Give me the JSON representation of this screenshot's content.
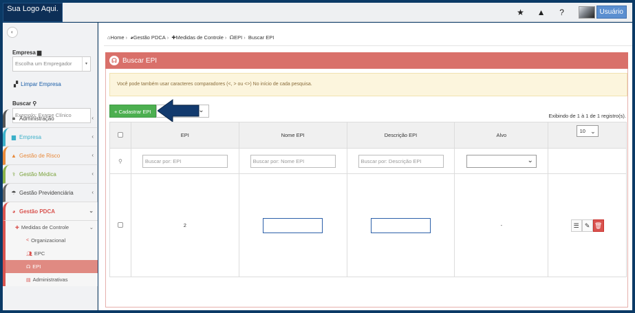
{
  "topbar": {
    "logo": "Sua Logo Aqui.",
    "icons": [
      "star-icon",
      "warning-icon",
      "help-icon"
    ],
    "user_label": "Usuário"
  },
  "sidebar": {
    "empresa_label": "Empresa",
    "empresa_placeholder": "Escolha um Empregador",
    "limpar_label": "Limpar Empresa",
    "buscar_label": "Buscar",
    "buscar_placeholder": "Exemplo: Exame Clínico",
    "menu": [
      {
        "label": "Administração"
      },
      {
        "label": "Empresa"
      },
      {
        "label": "Gestão de Risco"
      },
      {
        "label": "Gestão Médica"
      },
      {
        "label": "Gestão Previdenciária"
      },
      {
        "label": "Gestão PDCA"
      }
    ],
    "submenu": {
      "group": "Medidas de Controle",
      "items": [
        "Organizacional",
        "EPC",
        "EPI",
        "Administrativas"
      ]
    }
  },
  "breadcrumb": [
    "Home",
    "Gestão PDCA",
    "Medidas de Controle",
    "EPI",
    "Buscar EPI"
  ],
  "panel": {
    "title": "Buscar EPI",
    "alert": "Você pode também usar caracteres comparadores (<, > ou <>) No início de cada pesquisa.",
    "add_button": "+ Cadastrar EPI",
    "showing": "Exibindo de 1 à 1 de 1 registro(s)."
  },
  "table": {
    "columns": [
      "EPI",
      "Nome EPI",
      "Descrição EPI",
      "Alvo"
    ],
    "page_length": "10",
    "filters": {
      "epi": "Buscar por: EPI",
      "nome": "Buscar por: Nome EPI",
      "descricao": "Buscar por: Descrição EPI"
    },
    "rows": [
      {
        "epi": "2",
        "nome": "",
        "descricao": "",
        "alvo": "-"
      }
    ]
  }
}
